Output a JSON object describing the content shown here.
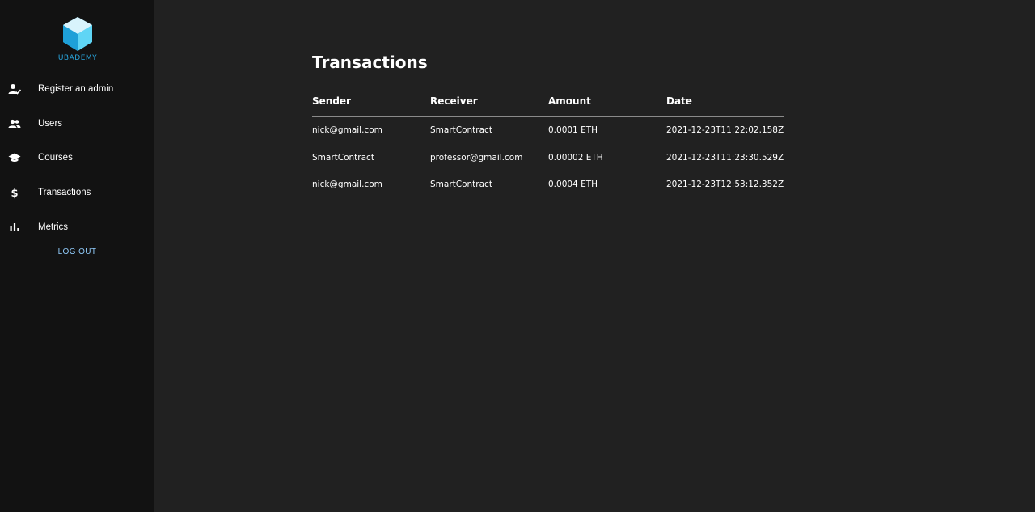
{
  "brand": {
    "logo_text": "UBADEMY",
    "accent": "#29a8e0"
  },
  "sidebar": {
    "items": [
      {
        "label": "Register an admin",
        "icon": "user-check-icon"
      },
      {
        "label": "Users",
        "icon": "users-icon"
      },
      {
        "label": "Courses",
        "icon": "graduation-cap-icon"
      },
      {
        "label": "Transactions",
        "icon": "dollar-icon"
      },
      {
        "label": "Metrics",
        "icon": "bar-chart-icon"
      }
    ],
    "logout_label": "LOG OUT"
  },
  "main": {
    "title": "Transactions",
    "table": {
      "columns": [
        "Sender",
        "Receiver",
        "Amount",
        "Date"
      ],
      "rows": [
        [
          "nick@gmail.com",
          "SmartContract",
          "0.0001 ETH",
          "2021-12-23T11:22:02.158Z"
        ],
        [
          "SmartContract",
          "professor@gmail.com",
          "0.00002 ETH",
          "2021-12-23T11:23:30.529Z"
        ],
        [
          "nick@gmail.com",
          "SmartContract",
          "0.0004 ETH",
          "2021-12-23T12:53:12.352Z"
        ]
      ]
    }
  }
}
